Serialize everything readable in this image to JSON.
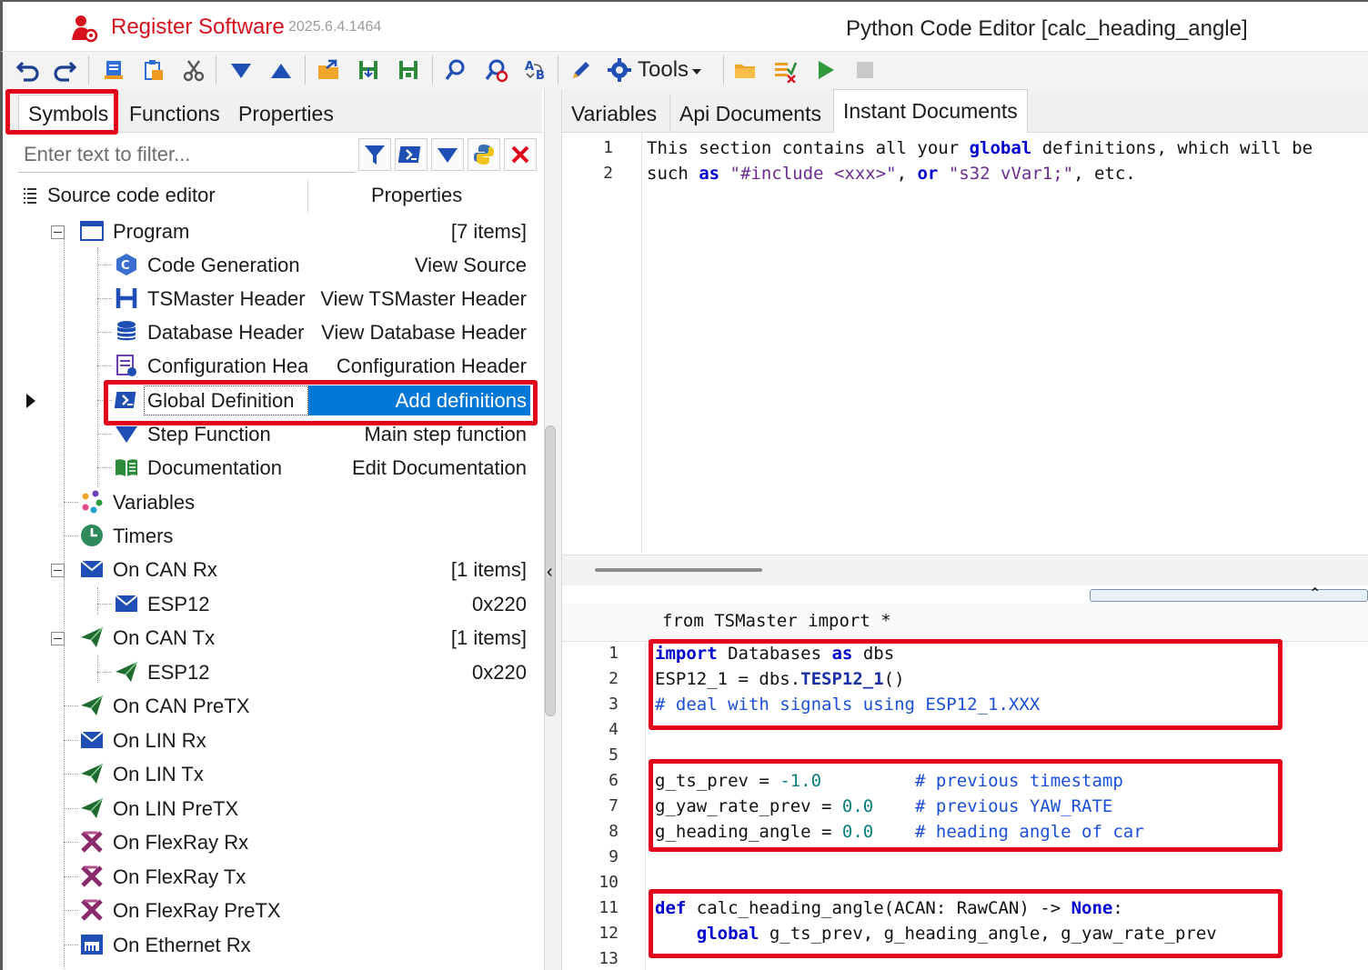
{
  "app": {
    "title": "Register Software",
    "version": "2025.6.4.1464",
    "editor_title": "Python Code Editor [calc_heading_angle]"
  },
  "toolbar": {
    "tools_label": "Tools",
    "icons": [
      "undo-icon",
      "redo-icon",
      "copy-icon",
      "paste-icon",
      "cut-icon",
      "move-down-icon",
      "move-up-icon",
      "open-folder-icon",
      "save-icon",
      "save-all-icon",
      "search-icon",
      "find-replace-icon",
      "ab-replace-icon",
      "edit-icon",
      "gear-icon",
      "folder-icon",
      "check-edit-icon",
      "run-icon",
      "stop-icon"
    ]
  },
  "left_tabs": [
    "Symbols",
    "Functions",
    "Properties"
  ],
  "filter": {
    "placeholder": "Enter text to filter..."
  },
  "tree_header": {
    "col1": "Source code editor",
    "col2": "Properties"
  },
  "tree": [
    {
      "label": "Program",
      "value": "[7 items]"
    },
    {
      "label": "Code Generation",
      "value": "View Source"
    },
    {
      "label": "TSMaster Header",
      "value": "View TSMaster Header"
    },
    {
      "label": "Database Header",
      "value": "View Database Header"
    },
    {
      "label": "Configuration Header",
      "value": "Configuration Header"
    },
    {
      "label": "Global Definition",
      "value": "Add definitions"
    },
    {
      "label": "Step Function",
      "value": "Main step function"
    },
    {
      "label": "Documentation",
      "value": "Edit Documentation"
    },
    {
      "label": "Variables",
      "value": ""
    },
    {
      "label": "Timers",
      "value": ""
    },
    {
      "label": "On CAN Rx",
      "value": "[1 items]"
    },
    {
      "label": "ESP12",
      "value": "0x220"
    },
    {
      "label": "On CAN Tx",
      "value": "[1 items]"
    },
    {
      "label": "ESP12",
      "value": "0x220"
    },
    {
      "label": "On CAN PreTX",
      "value": ""
    },
    {
      "label": "On LIN Rx",
      "value": ""
    },
    {
      "label": "On LIN Tx",
      "value": ""
    },
    {
      "label": "On LIN PreTX",
      "value": ""
    },
    {
      "label": "On FlexRay Rx",
      "value": ""
    },
    {
      "label": "On FlexRay Tx",
      "value": ""
    },
    {
      "label": "On FlexRay PreTX",
      "value": ""
    },
    {
      "label": "On Ethernet Rx",
      "value": ""
    }
  ],
  "right_tabs": [
    "Variables",
    "Api Documents",
    "Instant Documents"
  ],
  "top_code": {
    "lines": [
      "1",
      "2"
    ]
  },
  "bottom_header": "from TSMaster import *",
  "bottom_code": {
    "line_numbers": [
      "1",
      "2",
      "3",
      "4",
      "5",
      "6",
      "7",
      "8",
      "9",
      "10",
      "11",
      "12",
      "13"
    ]
  },
  "colors": {
    "accent": "#0078d7",
    "highlight": "#e2001a",
    "brand": "#d6101c"
  }
}
